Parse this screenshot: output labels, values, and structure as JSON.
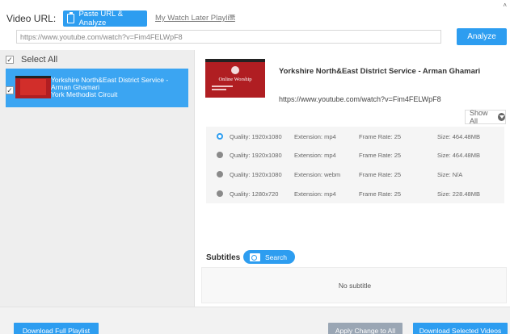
{
  "header": {
    "url_label": "Video URL:",
    "paste_button": "Paste URL & Analyze",
    "watch_later": "My Watch Later Playlist",
    "url_input_value": "https://www.youtube.com/watch?v=Fim4FELWpF8",
    "analyze_button": "Analyze",
    "corner_mark": "˄"
  },
  "sidebar": {
    "select_all": "Select All",
    "select_all_checked": true,
    "items": [
      {
        "title": "Yorkshire North&East District Service -",
        "author": "Arman Ghamari",
        "channel": "York Methodist Circuit",
        "checked": true
      }
    ]
  },
  "detail": {
    "title": "Yorkshire North&East District Service - Arman Ghamari",
    "url": "https://www.youtube.com/watch?v=Fim4FELWpF8",
    "thumbnail_text": "Online Worship",
    "show_all": "Show All",
    "qualities": [
      {
        "quality": "Quality: 1920x1080",
        "extension": "Extension: mp4",
        "frame_rate": "Frame Rate: 25",
        "size": "Size: 464.48MB",
        "selected": true
      },
      {
        "quality": "Quality: 1920x1080",
        "extension": "Extension: mp4",
        "frame_rate": "Frame Rate: 25",
        "size": "Size: 464.48MB",
        "selected": false
      },
      {
        "quality": "Quality: 1920x1080",
        "extension": "Extension: webm",
        "frame_rate": "Frame Rate: 25",
        "size": "Size: N/A",
        "selected": false
      },
      {
        "quality": "Quality: 1280x720",
        "extension": "Extension: mp4",
        "frame_rate": "Frame Rate: 25",
        "size": "Size: 228.48MB",
        "selected": false
      }
    ],
    "subtitles_label": "Subtitles",
    "search_button": "Search",
    "no_subtitle": "No subtitle"
  },
  "footer": {
    "download_playlist": "Download Full Playlist",
    "apply_all": "Apply Change to All",
    "download_selected": "Download Selected Videos"
  },
  "colors": {
    "accent": "#2d9df0",
    "selected_item": "#3ba5f2",
    "thumbnail_red": "#b01e22",
    "disabled_button": "#9aa6b4"
  }
}
